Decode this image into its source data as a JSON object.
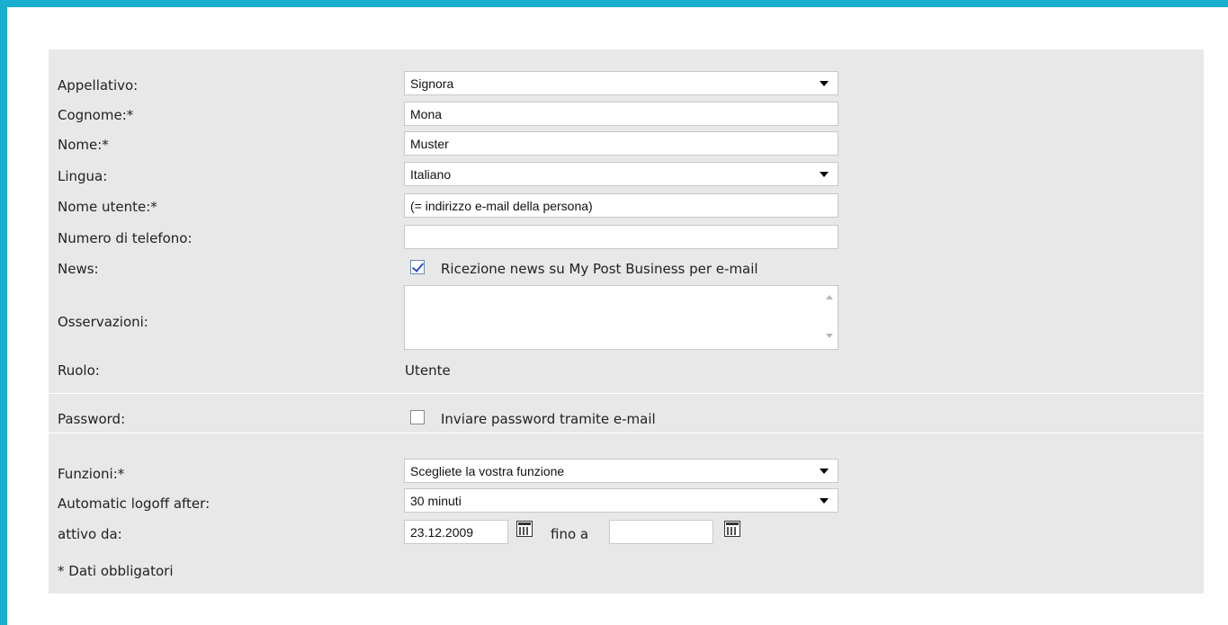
{
  "form": {
    "appellativo": {
      "label": "Appellativo:",
      "value": "Signora"
    },
    "cognome": {
      "label": "Cognome:*",
      "value": "Mona"
    },
    "nome": {
      "label": "Nome:*",
      "value": "Muster"
    },
    "lingua": {
      "label": "Lingua:",
      "value": "Italiano"
    },
    "nome_utente": {
      "label": "Nome utente:*",
      "value": "(= indirizzo e-mail della persona)"
    },
    "telefono": {
      "label": "Numero di telefono:",
      "value": ""
    },
    "news": {
      "label": "News:",
      "checkbox_label": "Ricezione news su My Post Business per e-mail",
      "checked": true
    },
    "osservazioni": {
      "label": "Osservazioni:",
      "value": ""
    },
    "ruolo": {
      "label": "Ruolo:",
      "value": "Utente"
    },
    "password": {
      "label": "Password:",
      "checkbox_label": "Inviare password tramite e-mail",
      "checked": false
    },
    "funzioni": {
      "label": "Funzioni:*",
      "value": "Scegliete la vostra funzione"
    },
    "logoff": {
      "label": "Automatic logoff after:",
      "value": "30 minuti"
    },
    "attivo": {
      "label": "attivo da:",
      "from_value": "23.12.2009",
      "to_label": "fino a",
      "to_value": ""
    },
    "note": "* Dati obbligatori"
  },
  "colors": {
    "frame": "#1aafd0",
    "panel": "#e8e8e8",
    "check": "#2b54c0"
  }
}
